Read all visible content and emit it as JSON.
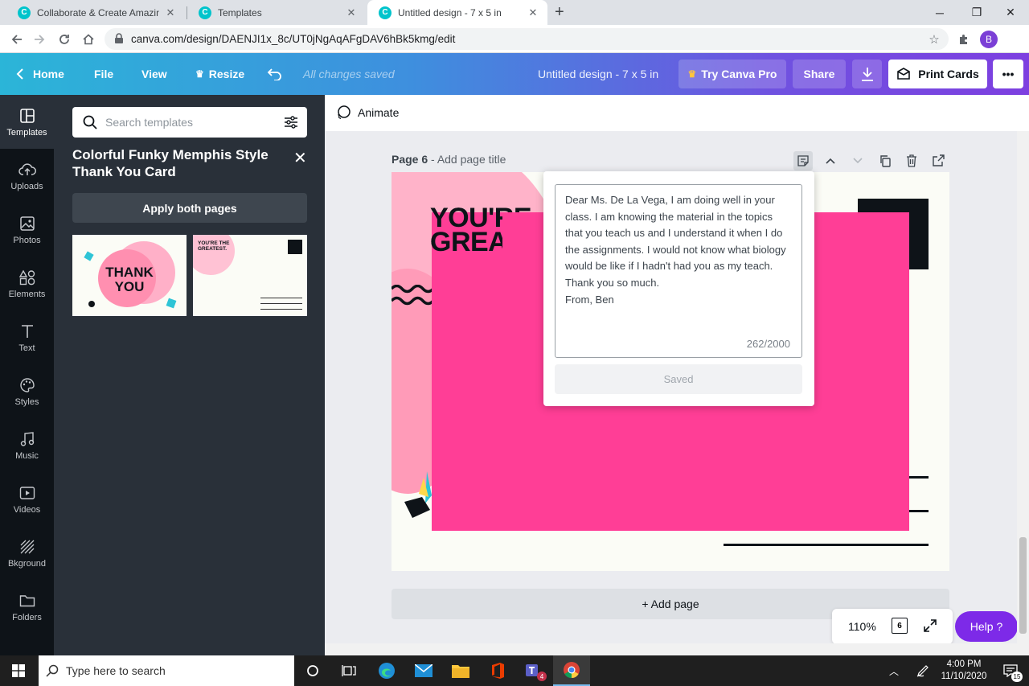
{
  "browser": {
    "tabs": [
      {
        "title": "Collaborate & Create Amazing G",
        "favicon": "C"
      },
      {
        "title": "Templates",
        "favicon": "C"
      },
      {
        "title": "Untitled design - 7 x 5 in",
        "favicon": "C"
      }
    ],
    "url": "canva.com/design/DAENJI1x_8c/UT0jNgAqAFgDAV6hBk5kmg/edit",
    "avatar": "B"
  },
  "topbar": {
    "home": "Home",
    "file": "File",
    "view": "View",
    "resize": "Resize",
    "status": "All changes saved",
    "title": "Untitled design - 7 x 5 in",
    "try_pro": "Try Canva Pro",
    "share": "Share",
    "print": "Print Cards",
    "more": "•••"
  },
  "rail": [
    {
      "label": "Templates",
      "icon": "templates-icon"
    },
    {
      "label": "Uploads",
      "icon": "uploads-icon"
    },
    {
      "label": "Photos",
      "icon": "photos-icon"
    },
    {
      "label": "Elements",
      "icon": "elements-icon"
    },
    {
      "label": "Text",
      "icon": "text-icon"
    },
    {
      "label": "Styles",
      "icon": "styles-icon"
    },
    {
      "label": "Music",
      "icon": "music-icon"
    },
    {
      "label": "Videos",
      "icon": "videos-icon"
    },
    {
      "label": "Bkground",
      "icon": "background-icon"
    },
    {
      "label": "Folders",
      "icon": "folders-icon"
    }
  ],
  "panel": {
    "search_placeholder": "Search templates",
    "template_title": "Colorful Funky Memphis Style Thank You Card",
    "apply": "Apply both pages",
    "thumb1_text_a": "THANK",
    "thumb1_text_b": "YOU",
    "thumb2_text_a": "YOU'RE THE",
    "thumb2_text_b": "GREATEST."
  },
  "editor": {
    "animate": "Animate",
    "page_num": "Page 6",
    "page_title_placeholder": "Add page title",
    "canvas_text_a": "YOU'RE",
    "canvas_text_b": "GREATES",
    "add_page": "+ Add page",
    "zoom": "110%",
    "page_count": "6",
    "help": "Help  ?"
  },
  "notes": {
    "text": "Dear Ms. De La Vega, I am doing well in your class. I am knowing the material in the topics that you teach us and I understand it when I do the assignments. I would not know what biology would be like if I hadn't had you as my teach. Thank you so much.\nFrom, Ben",
    "counter": "262/2000",
    "saved": "Saved"
  },
  "taskbar": {
    "search_placeholder": "Type here to search",
    "time": "4:00 PM",
    "date": "11/10/2020",
    "notif_count": "15",
    "teams_badge": "4"
  },
  "colors": {
    "canvas_pink": "#ff3e96",
    "help_purple": "#7d2ae8",
    "rail_bg": "#0e1318",
    "panel_bg": "#293039"
  }
}
